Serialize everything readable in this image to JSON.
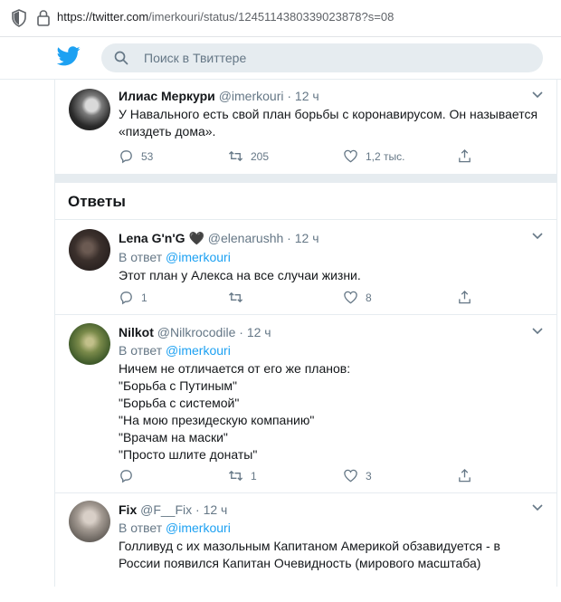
{
  "browser": {
    "url_host": "https://twitter.com",
    "url_path": "/imerkouri/status/1245114380339023878?s=08"
  },
  "header": {
    "logo_icon": "twitter-bird-icon",
    "search_placeholder": "Поиск в Твиттере"
  },
  "main_tweet": {
    "name": "Илиас Меркури",
    "handle": "@imerkouri",
    "dot": "·",
    "time": "12 ч",
    "text_lines": [
      "У Навального есть свой план борьбы с коронавирусом. Он называется",
      "«пиздеть дома»."
    ],
    "replies": "53",
    "retweets": "205",
    "likes": "1,2 тыс."
  },
  "answers_label": "Ответы",
  "replies": [
    {
      "name": "Lena G'n'G",
      "heart": "🖤",
      "handle": "@elenarushh",
      "time": "12 ч",
      "reply_to_prefix": "В ответ",
      "reply_to_mention": "@imerkouri",
      "text_lines": [
        "Этот план у Алекса на все случаи жизни."
      ],
      "replies": "1",
      "retweets": "",
      "likes": "8"
    },
    {
      "name": "Nilkot",
      "handle": "@Nilkrocodile",
      "time": "12 ч",
      "reply_to_prefix": "В ответ",
      "reply_to_mention": "@imerkouri",
      "text_lines": [
        "Ничем не отличается от его же планов:",
        "\"Борьба с Путиным\"",
        "\"Борьба с системой\"",
        "\"На мою президескую компанию\"",
        "\"Врачам на маски\"",
        "\"Просто шлите донаты\""
      ],
      "replies": "",
      "retweets": "1",
      "likes": "3"
    },
    {
      "name": "Fix",
      "handle": "@F__Fix",
      "time": "12 ч",
      "reply_to_prefix": "В ответ",
      "reply_to_mention": "@imerkouri",
      "text_lines": [
        "Голливуд с их мазольным Капитаном Америкой обзавидуется - в",
        "России появился Капитан Очевидность (мирового масштаба)"
      ]
    }
  ],
  "colors": {
    "accent": "#1da1f2",
    "muted": "#657786",
    "border": "#e6ecf0"
  }
}
